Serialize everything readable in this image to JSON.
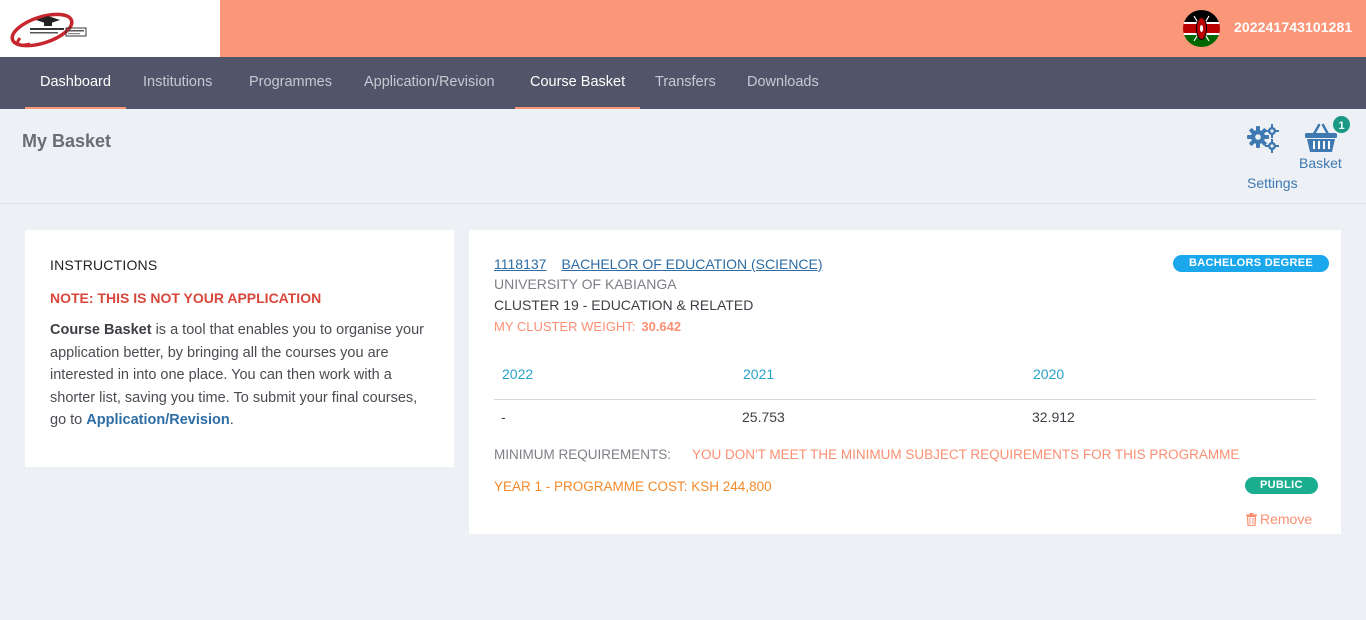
{
  "header": {
    "logo": "kuccps-logo",
    "flag": "kenya-flag",
    "user_id": "202241743101281"
  },
  "nav": {
    "items": [
      {
        "label": "Dashboard",
        "active": true
      },
      {
        "label": "Institutions",
        "active": false
      },
      {
        "label": "Programmes",
        "active": false
      },
      {
        "label": "Application/Revision",
        "active": false
      },
      {
        "label": "Course Basket",
        "active": true
      },
      {
        "label": "Transfers",
        "active": false
      },
      {
        "label": "Downloads",
        "active": false
      }
    ]
  },
  "page": {
    "title": "My Basket",
    "settings_label": "Settings",
    "basket_label": "Basket",
    "basket_count": "1"
  },
  "instructions": {
    "heading": "INSTRUCTIONS",
    "note": "NOTE: THIS IS NOT YOUR APPLICATION",
    "body_bold": "Course Basket",
    "body_text": " is a tool that enables you to organise your application better, by bringing all the courses you are interested in into one place. You can then work with a shorter list, saving you time. To submit your final courses, go to ",
    "link_text": "Application/Revision",
    "body_end": "."
  },
  "course": {
    "code": "1118137",
    "name": "BACHELOR OF EDUCATION (SCIENCE)",
    "degree_badge": "BACHELORS DEGREE",
    "university": "UNIVERSITY OF KABIANGA",
    "cluster": "CLUSTER 19 - EDUCATION & RELATED",
    "weight_label": "MY CLUSTER WEIGHT:",
    "weight_value": "30.642",
    "years": [
      "2022",
      "2021",
      "2020"
    ],
    "cutoffs": [
      "-",
      "25.753",
      "32.912"
    ],
    "minreq_label": "MINIMUM REQUIREMENTS:",
    "minreq_value": "YOU DON'T MEET THE MINIMUM SUBJECT REQUIREMENTS FOR THIS PROGRAMME",
    "cost": "YEAR 1 - PROGRAMME COST: KSH 244,800",
    "type_badge": "PUBLIC",
    "remove_label": "Remove"
  },
  "colors": {
    "topbar": "#fb9779",
    "navbar": "#525569",
    "link": "#2e6da4",
    "degree_badge": "#1aa7ec",
    "public_badge": "#1aae8f",
    "warning": "#d9473b"
  }
}
